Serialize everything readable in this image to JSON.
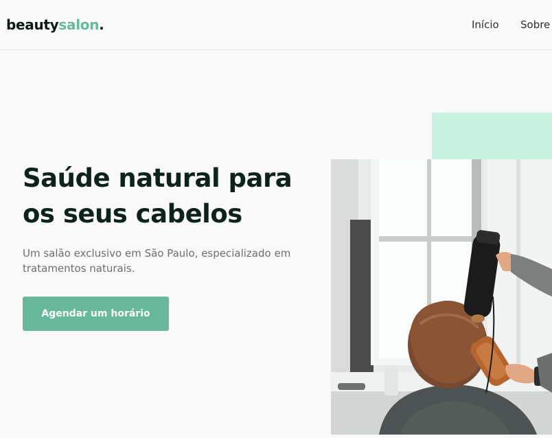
{
  "header": {
    "logo": {
      "part1": "beauty",
      "part2": "salon",
      "part3": "."
    },
    "nav": [
      {
        "label": "Início"
      },
      {
        "label": "Sobre"
      }
    ]
  },
  "hero": {
    "title": "Saúde natural para os seus cabelos",
    "subtitle": "Um salão exclusivo em São Paulo, especializado em tratamentos naturais.",
    "cta_label": "Agendar um horário"
  },
  "colors": {
    "accent": "#67b99a",
    "accent_light": "#c9f2e2",
    "heading": "#0d2319",
    "body_text": "#6e6e6e",
    "background": "#f9f9f9"
  }
}
